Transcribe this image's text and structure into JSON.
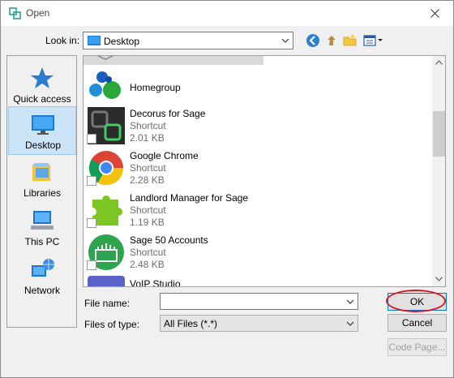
{
  "window": {
    "title": "Open"
  },
  "toolbar": {
    "look_in_label": "Look in:",
    "look_in_value": "Desktop"
  },
  "places": [
    {
      "label": "Quick access",
      "icon": "star-icon"
    },
    {
      "label": "Desktop",
      "icon": "desktop-icon",
      "selected": true
    },
    {
      "label": "Libraries",
      "icon": "libraries-icon"
    },
    {
      "label": "This PC",
      "icon": "computer-icon"
    },
    {
      "label": "Network",
      "icon": "network-icon"
    }
  ],
  "files": {
    "homegroup": {
      "name": "Homegroup",
      "icon": "homegroup-icon"
    },
    "items": [
      {
        "name": "Decorus for Sage",
        "type": "Shortcut",
        "size": "2.01 KB",
        "icon": "decorus-icon"
      },
      {
        "name": "Google Chrome",
        "type": "Shortcut",
        "size": "2.28 KB",
        "icon": "chrome-icon"
      },
      {
        "name": "Landlord Manager for Sage",
        "type": "Shortcut",
        "size": "1.19 KB",
        "icon": "puzzle-icon"
      },
      {
        "name": "Sage 50 Accounts",
        "type": "Shortcut",
        "size": "2.48 KB",
        "icon": "sage50-icon"
      }
    ],
    "partial_item": {
      "name": "VoIP Studio"
    }
  },
  "form": {
    "file_name_label": "File name:",
    "file_name_value": "",
    "file_type_label": "Files of type:",
    "file_type_value": "All Files (*.*)"
  },
  "buttons": {
    "ok": "OK",
    "cancel": "Cancel",
    "code_page": "Code Page..."
  },
  "colors": {
    "selection": "#cce4f7",
    "highlight_ring": "#d9171e",
    "accent": "#0078d7"
  }
}
